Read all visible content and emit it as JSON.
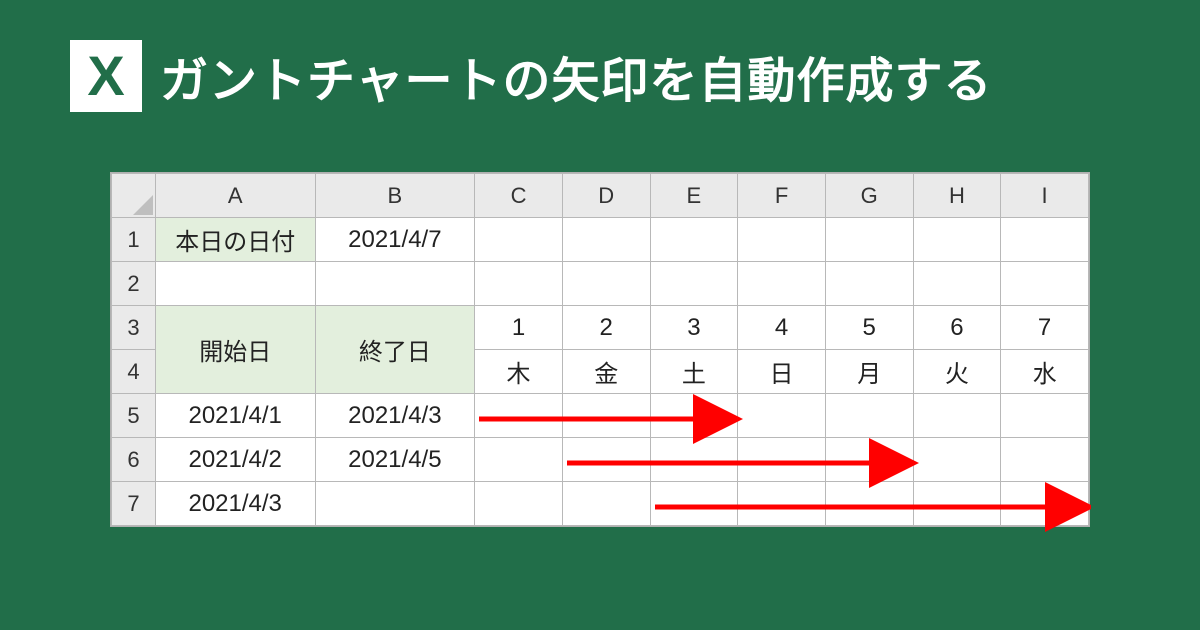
{
  "header": {
    "badge_letter": "X",
    "title": "ガントチャートの矢印を自動作成する"
  },
  "sheet": {
    "col_letters": [
      "A",
      "B",
      "C",
      "D",
      "E",
      "F",
      "G",
      "H",
      "I"
    ],
    "row_numbers": [
      "1",
      "2",
      "3",
      "4",
      "5",
      "6",
      "7"
    ],
    "a1_label": "本日の日付",
    "b1_value": "2021/4/7",
    "a3_label": "開始日",
    "b3_label": "終了日",
    "day_numbers": [
      "1",
      "2",
      "3",
      "4",
      "5",
      "6",
      "7"
    ],
    "day_names": [
      "木",
      "金",
      "土",
      "日",
      "月",
      "火",
      "水"
    ],
    "rows": [
      {
        "start": "2021/4/1",
        "end": "2021/4/3"
      },
      {
        "start": "2021/4/2",
        "end": "2021/4/5"
      },
      {
        "start": "2021/4/3",
        "end": ""
      }
    ],
    "arrow_color": "#ff0000"
  },
  "chart_data": {
    "type": "gantt",
    "title": "ガントチャート",
    "date_axis": [
      "2021/4/1",
      "2021/4/2",
      "2021/4/3",
      "2021/4/4",
      "2021/4/5",
      "2021/4/6",
      "2021/4/7"
    ],
    "tasks": [
      {
        "start": "2021/4/1",
        "end": "2021/4/3"
      },
      {
        "start": "2021/4/2",
        "end": "2021/4/5"
      },
      {
        "start": "2021/4/3",
        "end": "2021/4/7"
      }
    ]
  }
}
